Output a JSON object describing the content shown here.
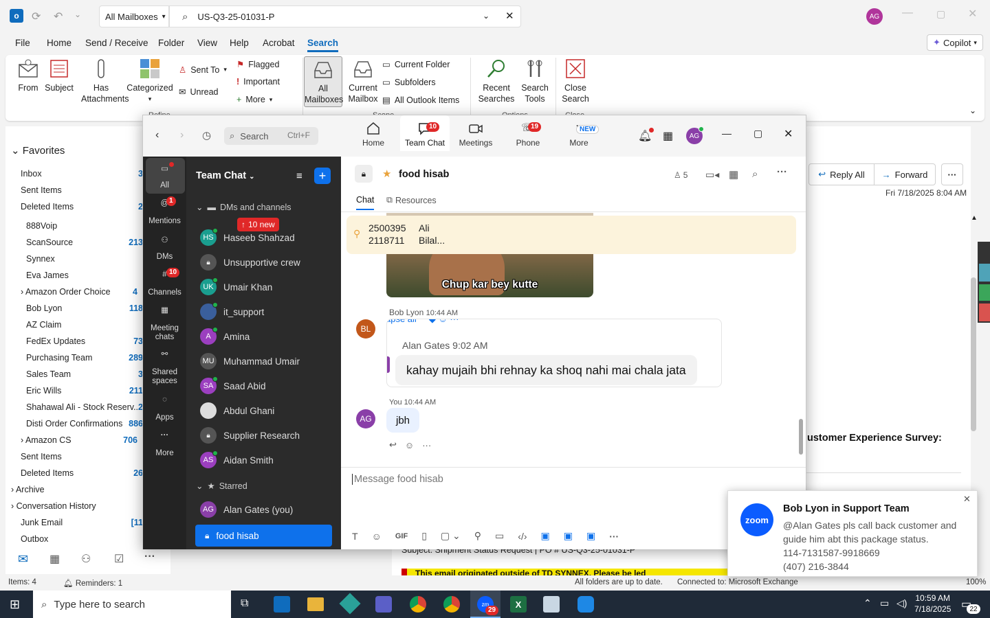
{
  "outlook": {
    "mailbox_scope": "All Mailboxes",
    "search_value": "US-Q3-25-01031-P",
    "avatar": "AG",
    "menu": [
      "File",
      "Home",
      "Send / Receive",
      "Folder",
      "View",
      "Help",
      "Acrobat",
      "Search"
    ],
    "copilot": "Copilot",
    "ribbon": {
      "from": "From",
      "subject": "Subject",
      "has_attachments": "Has Attachments",
      "categorized": "Categorized",
      "sent_to": "Sent To",
      "unread": "Unread",
      "flagged": "Flagged",
      "important": "Important",
      "more": "More",
      "all_mailboxes": "All Mailboxes",
      "current_mailbox": "Current Mailbox",
      "current_folder": "Current Folder",
      "subfolders": "Subfolders",
      "all_outlook_items": "All Outlook Items",
      "recent_searches": "Recent Searches",
      "search_tools": "Search Tools",
      "close_search": "Close Search",
      "group_refine": "Refine",
      "group_scope": "Scope",
      "group_options": "Options",
      "group_close": "Close"
    },
    "favorites_header": "Favorites",
    "folders": [
      {
        "label": "Inbox",
        "count": "3"
      },
      {
        "label": "Sent Items",
        "count": ""
      },
      {
        "label": "Deleted Items",
        "count": "2"
      },
      {
        "label": "888Voip",
        "count": ""
      },
      {
        "label": "ScanSource",
        "count": "213"
      },
      {
        "label": "Synnex",
        "count": ""
      },
      {
        "label": "Eva James",
        "count": ""
      },
      {
        "label": "Amazon Order Choice",
        "count": "4"
      },
      {
        "label": "Bob Lyon",
        "count": "118"
      },
      {
        "label": "AZ Claim",
        "count": ""
      },
      {
        "label": "FedEx Updates",
        "count": "73"
      },
      {
        "label": "Purchasing Team",
        "count": "289"
      },
      {
        "label": "Sales Team",
        "count": "3"
      },
      {
        "label": "Eric Wills",
        "count": "211"
      },
      {
        "label": "Shahawal Ali - Stock Reserv...",
        "count": "2"
      },
      {
        "label": "Disti Order Confirmations",
        "count": "886"
      },
      {
        "label": "Amazon CS",
        "count": "706"
      },
      {
        "label": "Sent Items",
        "count": ""
      },
      {
        "label": "Deleted Items",
        "count": "26"
      },
      {
        "label": "Archive",
        "count": ""
      },
      {
        "label": "Conversation History",
        "count": ""
      },
      {
        "label": "Junk Email",
        "count": "[11"
      },
      {
        "label": "Outbox",
        "count": ""
      }
    ],
    "reading": {
      "reply_all": "Reply All",
      "forward": "Forward",
      "date": "Fri 7/18/2025 8:04 AM",
      "survey_text": "ustomer Experience Survey:",
      "subject_line": "Subject: Shipment Status Request | PO # US-Q3-25-01031-P",
      "banner": "This email originated outside of TD SYNNEX. Please be led"
    },
    "status": {
      "items": "Items: 4",
      "reminders": "Reminders: 1",
      "sync": "All folders are up to date.",
      "connection": "Connected to: Microsoft Exchange",
      "zoom": "100%"
    }
  },
  "zoom": {
    "search_placeholder": "Search",
    "search_shortcut": "Ctrl+F",
    "tabs": [
      {
        "label": "Home",
        "badge": ""
      },
      {
        "label": "Team Chat",
        "badge": "10"
      },
      {
        "label": "Meetings",
        "badge": ""
      },
      {
        "label": "Phone",
        "badge": "19"
      },
      {
        "label": "More",
        "badge": "NEW"
      }
    ],
    "avatar": "AG",
    "rail": [
      {
        "label": "All",
        "badge": ""
      },
      {
        "label": "Mentions",
        "badge": "1"
      },
      {
        "label": "DMs",
        "badge": ""
      },
      {
        "label": "Channels",
        "badge": "10"
      },
      {
        "label": "Meeting chats",
        "badge": ""
      },
      {
        "label": "Shared spaces",
        "badge": ""
      },
      {
        "label": "Apps",
        "badge": ""
      },
      {
        "label": "More",
        "badge": ""
      }
    ],
    "list_title": "Team Chat",
    "section_dms": "DMs and channels",
    "new_pill": "10 new",
    "chats": [
      {
        "name": "Haseeb Shahzad",
        "initials": "HS",
        "color": "#1a9e8f"
      },
      {
        "name": "Unsupportive crew",
        "initials": "",
        "color": "#555"
      },
      {
        "name": "Umair Khan",
        "initials": "UK",
        "color": "#1a9e8f"
      },
      {
        "name": "it_support",
        "initials": "",
        "color": "#3a5f9c"
      },
      {
        "name": "Amina",
        "initials": "A",
        "color": "#9b3fbf"
      },
      {
        "name": "Muhammad Umair",
        "initials": "MU",
        "color": "#555"
      },
      {
        "name": "Saad Abid",
        "initials": "SA",
        "color": "#9b3fbf"
      },
      {
        "name": "Abdul Ghani",
        "initials": "",
        "color": "#ddd"
      },
      {
        "name": "Supplier Research",
        "initials": "",
        "color": "#555"
      },
      {
        "name": "Aidan Smith",
        "initials": "AS",
        "color": "#9b3fbf"
      }
    ],
    "section_starred": "Starred",
    "starred": [
      {
        "name": "Alan Gates (you)",
        "initials": "AG",
        "color": "#8a3fa8"
      },
      {
        "name": "food hisab",
        "initials": "",
        "color": "#0e71eb"
      }
    ],
    "channel_title": "food hisab",
    "member_count": "5",
    "subtab_chat": "Chat",
    "subtab_resources": "Resources",
    "pinned_line1_a": "2500395",
    "pinned_line1_b": "Ali",
    "pinned_line2_a": "2118711",
    "pinned_line2_b": "Bilal...",
    "meme_caption": "Chup kar bey kutte",
    "msg1_sender": "Bob Lyon",
    "msg1_time": "10:44 AM",
    "msg1_avatar": "BL",
    "collapse": "apse all",
    "quote_sender": "Alan Gates",
    "quote_time": "9:02 AM",
    "quote_text": "kahay mujaih bhi rehnay ka shoq nahi mai chala jata",
    "msg2_sender": "You",
    "msg2_time": "10:44 AM",
    "msg2_avatar": "AG",
    "msg2_text": "jbh",
    "composer_placeholder": "Message food hisab",
    "gif": "GIF"
  },
  "notification": {
    "app": "zoom",
    "title": "Bob Lyon in Support Team",
    "line1": "@Alan Gates pls call back customer and",
    "line2": "guide him abt this package status.",
    "line3": "114-7131587-9918669",
    "line4": "(407) 216-3844"
  },
  "taskbar": {
    "search_placeholder": "Type here to search",
    "time": "10:59 AM",
    "date": "7/18/2025",
    "notif_count": "22",
    "zoom_badge": "29"
  }
}
